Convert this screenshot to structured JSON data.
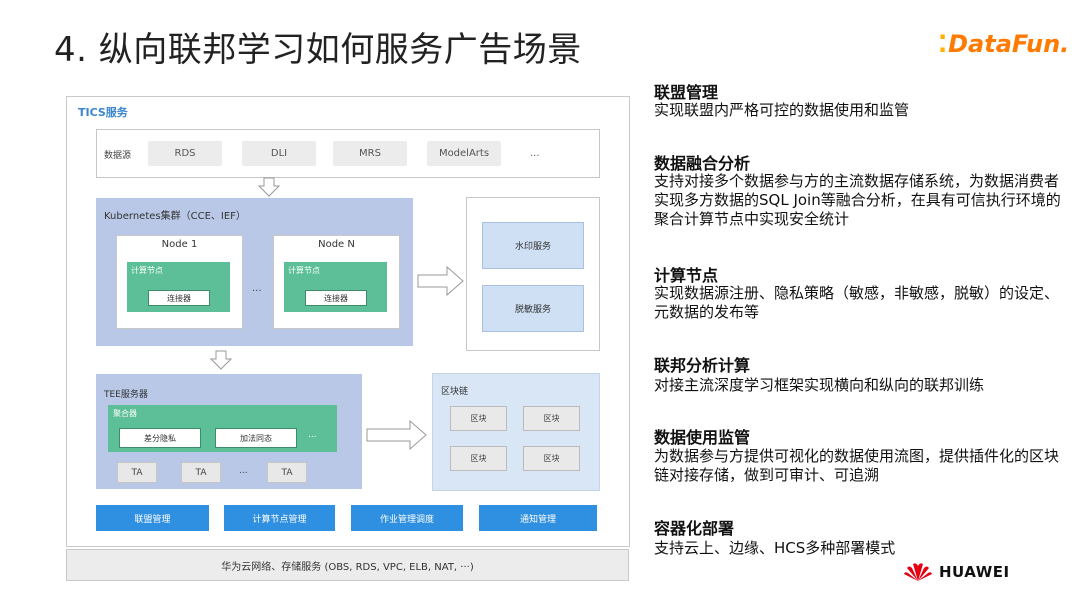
{
  "slide": {
    "title": "4. 纵向联邦学习如何服务广告场景",
    "logo_text": "DataFun.",
    "footer_brand": "HUAWEI"
  },
  "diagram": {
    "service_label": "TICS服务",
    "data_source": {
      "label": "数据源",
      "items": [
        "RDS",
        "DLI",
        "MRS",
        "ModelArts",
        "..."
      ]
    },
    "kubernetes": {
      "label": "Kubernetes集群（CCE、IEF）",
      "nodes": [
        {
          "name": "Node 1",
          "compute_label": "计算节点",
          "connector": "连接器"
        },
        {
          "name": "Node N",
          "compute_label": "计算节点",
          "connector": "连接器"
        }
      ],
      "between": "..."
    },
    "side_services": [
      "水印服务",
      "脱敏服务"
    ],
    "tee": {
      "label": "TEE服务器",
      "aggregator_label": "聚合器",
      "aggregator_items": [
        "差分隐私",
        "加法同态",
        "..."
      ],
      "ta_items": [
        "TA",
        "TA",
        "...",
        "TA"
      ]
    },
    "blockchain": {
      "label": "区块链",
      "blocks": [
        "区块",
        "区块",
        "区块",
        "区块"
      ]
    },
    "management": [
      "联盟管理",
      "计算节点管理",
      "作业管理调度",
      "通知管理"
    ],
    "cloud_bar": "华为云网络、存储服务 (OBS, RDS, VPC, ELB, NAT, ···)"
  },
  "sections": [
    {
      "heading": "联盟管理",
      "body": "实现联盟内严格可控的数据使用和监管"
    },
    {
      "heading": "数据融合分析",
      "body": "支持对接多个数据参与方的主流数据存储系统，为数据消费者实现多方数据的SQL Join等融合分析，在具有可信执行环境的聚合计算节点中实现安全统计"
    },
    {
      "heading": "计算节点",
      "body": "实现数据源注册、隐私策略（敏感，非敏感，脱敏）的设定、元数据的发布等"
    },
    {
      "heading": "联邦分析计算",
      "body": "对接主流深度学习框架实现横向和纵向的联邦训练"
    },
    {
      "heading": "数据使用监管",
      "body": "为数据参与方提供可视化的数据使用流图，提供插件化的区块链对接存储，做到可审计、可追溯"
    },
    {
      "heading": "容器化部署",
      "body": "支持云上、边缘、HCS多种部署模式"
    }
  ],
  "colors": {
    "green": "#5cbf97",
    "blue_panel": "#b8c8e6",
    "mgmt_blue": "#2f8fe0",
    "logo_orange": "#ff7a00",
    "huawei_red": "#e60012"
  }
}
